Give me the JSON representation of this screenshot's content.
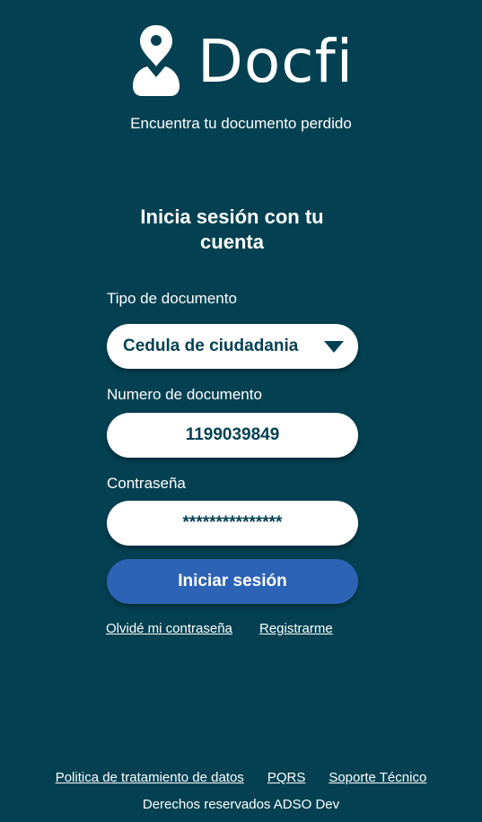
{
  "brand": {
    "name": "Docfi",
    "tagline": "Encuentra tu documento perdido",
    "logo_icon": "location-person-icon"
  },
  "login": {
    "heading": "Inicia sesión con tu cuenta",
    "doc_type_label": "Tipo de documento",
    "doc_type_value": "Cedula de ciudadania",
    "doc_number_label": "Numero de documento",
    "doc_number_value": "1199039849",
    "password_label": "Contraseña",
    "password_value": "***************",
    "submit_label": "Iniciar sesión",
    "forgot_label": "Olvidé mi contraseña",
    "register_label": "Registrarme"
  },
  "footer": {
    "links": [
      "Politica de tratamiento de datos",
      "PQRS",
      "Soporte Técnico"
    ],
    "copyright": "Derechos reservados ADSO Dev"
  },
  "colors": {
    "background": "#034152",
    "button": "#2c63b4",
    "field": "#ffffff"
  }
}
